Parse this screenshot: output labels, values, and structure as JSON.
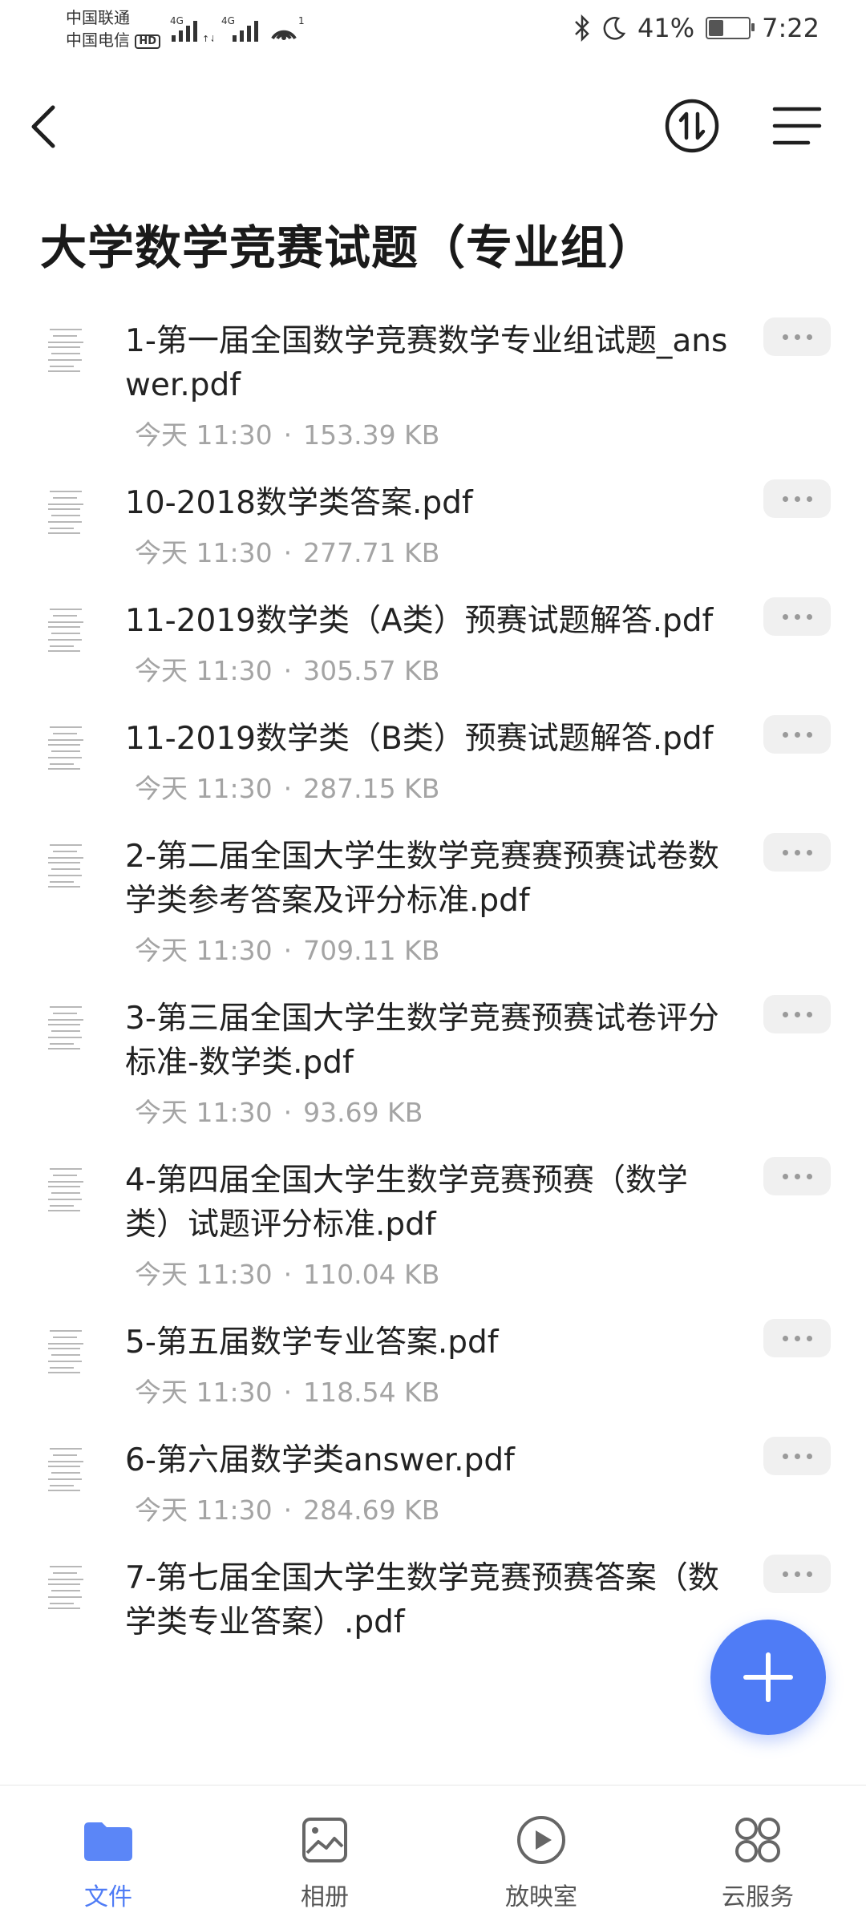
{
  "status_bar": {
    "carrier_1": "中国联通",
    "carrier_2": "中国电信",
    "hd": "HD",
    "network_1": "4G",
    "network_2": "4G",
    "hotspot_count": "1",
    "battery": "41%",
    "battery_level": 0.41,
    "time": "7:22",
    "icons": [
      "bluetooth-icon",
      "moon-icon",
      "battery-icon",
      "wifi-hotspot-icon",
      "signal-icon"
    ]
  },
  "header": {
    "title": "大学数学竞赛试题（专业组）",
    "icons": [
      "back-icon",
      "sort-icon",
      "menu-icon"
    ]
  },
  "files": [
    {
      "name": "1-第一届全国数学竞赛数学专业组试题_answer.pdf",
      "date": "今天 11:30",
      "size": "153.39 KB"
    },
    {
      "name": "10-2018数学类答案.pdf",
      "date": "今天 11:30",
      "size": "277.71 KB"
    },
    {
      "name": "11-2019数学类（A类）预赛试题解答.pdf",
      "date": "今天 11:30",
      "size": "305.57 KB"
    },
    {
      "name": "11-2019数学类（B类）预赛试题解答.pdf",
      "date": "今天 11:30",
      "size": "287.15 KB"
    },
    {
      "name": "2-第二届全国大学生数学竞赛赛预赛试卷数学类参考答案及评分标准.pdf",
      "date": "今天 11:30",
      "size": "709.11 KB"
    },
    {
      "name": "3-第三届全国大学生数学竞赛预赛试卷评分标准-数学类.pdf",
      "date": "今天 11:30",
      "size": "93.69 KB"
    },
    {
      "name": "4-第四届全国大学生数学竞赛预赛（数学类）试题评分标准.pdf",
      "date": "今天 11:30",
      "size": "110.04 KB"
    },
    {
      "name": "5-第五届数学专业答案.pdf",
      "date": "今天 11:30",
      "size": "118.54 KB"
    },
    {
      "name": "6-第六届数学类answer.pdf",
      "date": "今天 11:30",
      "size": "284.69 KB"
    },
    {
      "name": "7-第七届全国大学生数学竞赛预赛答案（数学类专业答案）.pdf",
      "date": "",
      "size": ""
    }
  ],
  "fab": {
    "icon": "plus-icon"
  },
  "bottom_nav": [
    {
      "label": "文件",
      "icon": "folder-icon",
      "active": true
    },
    {
      "label": "相册",
      "icon": "photo-icon",
      "active": false
    },
    {
      "label": "放映室",
      "icon": "play-icon",
      "active": false
    },
    {
      "label": "云服务",
      "icon": "grid-icon",
      "active": false
    }
  ],
  "colors": {
    "accent": "#4f7cf6",
    "meta_text": "#a4a4a4",
    "more_button_bg": "#f0f0f0"
  }
}
